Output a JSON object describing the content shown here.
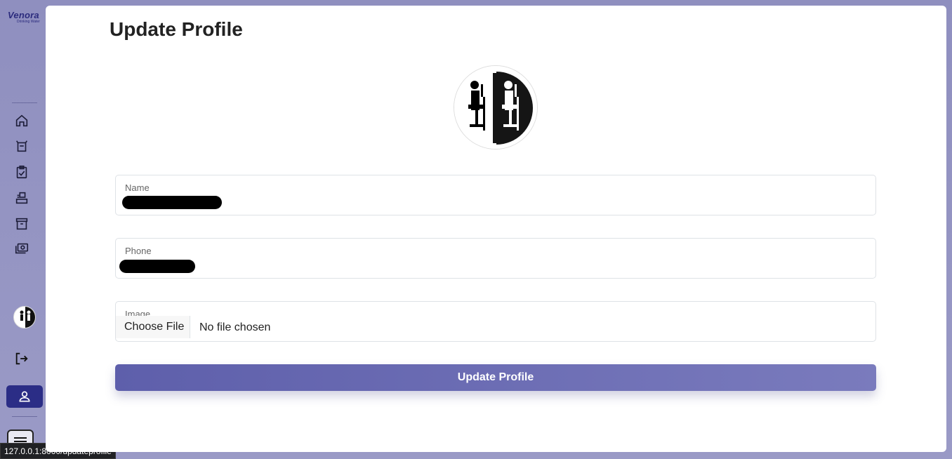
{
  "brand": {
    "name": "Venora",
    "tagline": "Drinking Water"
  },
  "sidebar": {
    "icons": [
      "home-icon",
      "basket-icon",
      "clipboard-check-icon",
      "inbox-tray-icon",
      "archive-icon",
      "money-icon"
    ],
    "logout_icon": "logout-icon",
    "active_icon": "user-icon",
    "menu_icon": "menu-icon"
  },
  "page": {
    "title": "Update Profile"
  },
  "form": {
    "name_label": "Name",
    "phone_label": "Phone",
    "image_label": "Image",
    "file_button": "Choose File",
    "file_status": "No file chosen",
    "submit_label": "Update Profile"
  },
  "status_bar": {
    "url": "127.0.0.1:8000/updateprofile"
  },
  "colors": {
    "accent": "#2b2d86",
    "button_start": "#5e5fab",
    "button_end": "#7a7bbd",
    "sidebar_bg": "#9393c2"
  }
}
